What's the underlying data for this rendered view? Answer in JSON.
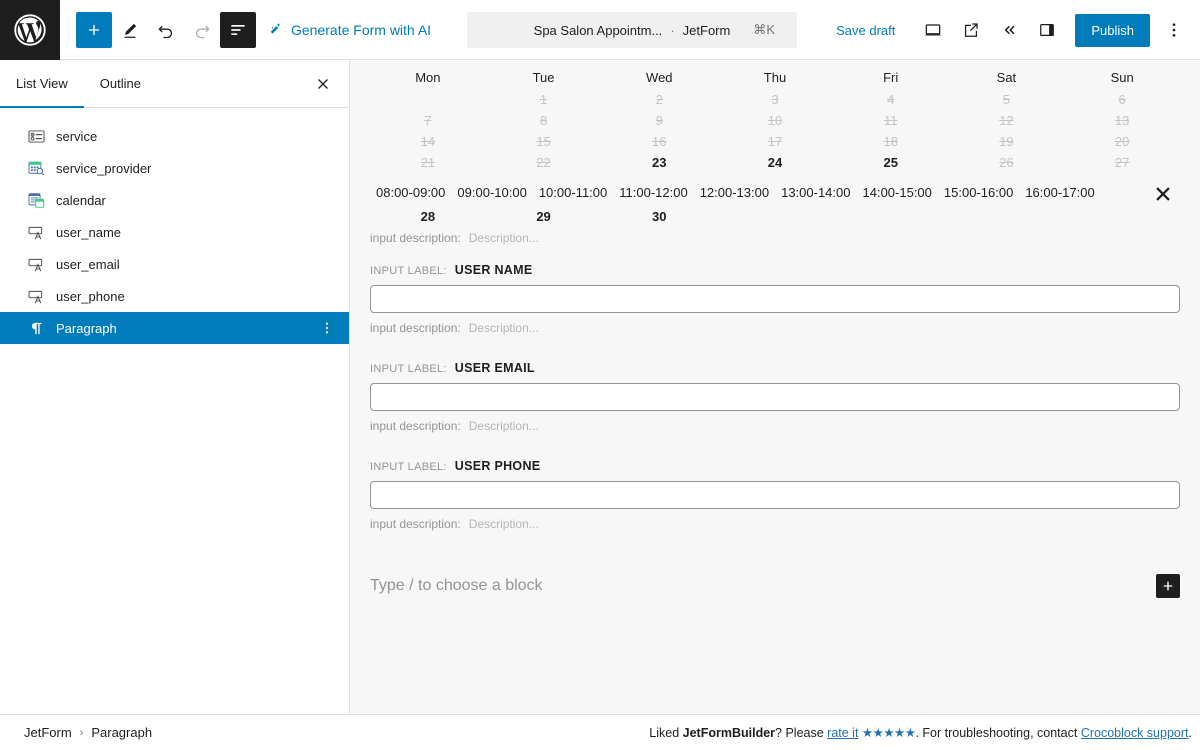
{
  "topbar": {
    "logo_icon": "wordpress-logo-icon",
    "tools": [
      {
        "name": "add-block-button",
        "icon": "plus-icon",
        "style": "primary",
        "label": "+"
      },
      {
        "name": "edit-tool-button",
        "icon": "pencil-icon",
        "style": "plain",
        "label": ""
      },
      {
        "name": "undo-button",
        "icon": "undo-icon",
        "style": "plain",
        "label": ""
      },
      {
        "name": "redo-button",
        "icon": "redo-icon",
        "style": "dim",
        "label": ""
      },
      {
        "name": "list-view-button",
        "icon": "list-view-icon",
        "style": "active",
        "label": ""
      }
    ],
    "ai_button_label": "Generate Form with AI",
    "ai_button_icon": "magic-wand-icon",
    "document_title": "Spa Salon Appointm...",
    "document_separator": "·",
    "document_type": "JetForm",
    "command_shortcut": "⌘K",
    "save_draft_label": "Save draft",
    "publish_label": "Publish",
    "right_icons": [
      {
        "name": "view-desktop-button",
        "icon": "desktop-icon"
      },
      {
        "name": "preview-external-button",
        "icon": "external-link-icon"
      },
      {
        "name": "collapse-button",
        "icon": "double-chevron-left-icon"
      },
      {
        "name": "settings-sidebar-button",
        "icon": "sidebar-panel-icon"
      }
    ],
    "options_icon": "kebab-menu-icon",
    "accent_color": "#007cba"
  },
  "sidebar": {
    "tabs": [
      {
        "label": "List View",
        "selected": true
      },
      {
        "label": "Outline",
        "selected": false
      }
    ],
    "close_icon": "close-icon",
    "items": [
      {
        "label": "service",
        "icon": "select-field-icon",
        "selected": false
      },
      {
        "label": "service_provider",
        "icon": "date-picker-icon",
        "selected": false
      },
      {
        "label": "calendar",
        "icon": "calendar-field-icon",
        "selected": false
      },
      {
        "label": "user_name",
        "icon": "text-field-icon",
        "selected": false
      },
      {
        "label": "user_email",
        "icon": "text-field-icon",
        "selected": false
      },
      {
        "label": "user_phone",
        "icon": "text-field-icon",
        "selected": false
      },
      {
        "label": "Paragraph",
        "icon": "paragraph-icon",
        "selected": true
      }
    ],
    "selected_more_icon": "kebab-menu-icon",
    "selected_color": "#007cba"
  },
  "canvas": {
    "calendar": {
      "weekdays": [
        "Mon",
        "Tue",
        "Wed",
        "Thu",
        "Fri",
        "Sat",
        "Sun"
      ],
      "weeks": [
        [
          {
            "d": "",
            "state": "blank"
          },
          {
            "d": "1",
            "state": "off"
          },
          {
            "d": "2",
            "state": "off"
          },
          {
            "d": "3",
            "state": "off"
          },
          {
            "d": "4",
            "state": "off"
          },
          {
            "d": "5",
            "state": "off"
          },
          {
            "d": "6",
            "state": "off"
          }
        ],
        [
          {
            "d": "7",
            "state": "off"
          },
          {
            "d": "8",
            "state": "off"
          },
          {
            "d": "9",
            "state": "off"
          },
          {
            "d": "10",
            "state": "off"
          },
          {
            "d": "11",
            "state": "off"
          },
          {
            "d": "12",
            "state": "off"
          },
          {
            "d": "13",
            "state": "off"
          }
        ],
        [
          {
            "d": "14",
            "state": "off"
          },
          {
            "d": "15",
            "state": "off"
          },
          {
            "d": "16",
            "state": "off"
          },
          {
            "d": "17",
            "state": "off"
          },
          {
            "d": "18",
            "state": "off"
          },
          {
            "d": "19",
            "state": "off"
          },
          {
            "d": "20",
            "state": "off"
          }
        ],
        [
          {
            "d": "21",
            "state": "off"
          },
          {
            "d": "22",
            "state": "off"
          },
          {
            "d": "23",
            "state": "on"
          },
          {
            "d": "24",
            "state": "on"
          },
          {
            "d": "25",
            "state": "on"
          },
          {
            "d": "26",
            "state": "off"
          },
          {
            "d": "27",
            "state": "off"
          }
        ]
      ],
      "tail_row": [
        "28",
        "29",
        "30",
        "",
        "",
        "",
        ""
      ],
      "timeslots": [
        "08:00-09:00",
        "09:00-10:00",
        "10:00-11:00",
        "11:00-12:00",
        "12:00-13:00",
        "13:00-14:00",
        "14:00-15:00",
        "15:00-16:00",
        "16:00-17:00"
      ],
      "timeslots_close_icon": "close-icon",
      "description_key": "input description:",
      "description_value": "Description..."
    },
    "fields": [
      {
        "label_key": "INPUT LABEL:",
        "label_value": "USER NAME",
        "value": "",
        "desc_key": "input description:",
        "desc_value": "Description..."
      },
      {
        "label_key": "INPUT LABEL:",
        "label_value": "USER EMAIL",
        "value": "",
        "desc_key": "input description:",
        "desc_value": "Description..."
      },
      {
        "label_key": "INPUT LABEL:",
        "label_value": "USER PHONE",
        "value": "",
        "desc_key": "input description:",
        "desc_value": "Description..."
      }
    ],
    "appender": {
      "placeholder": "Type / to choose a block",
      "add_icon": "plus-icon"
    }
  },
  "footer": {
    "breadcrumb": [
      "JetForm",
      "Paragraph"
    ],
    "breadcrumb_separator": "›",
    "credit_prefix": "Liked ",
    "credit_brand": "JetFormBuilder",
    "credit_mid": "? Please ",
    "credit_rate_link": "rate it",
    "credit_stars": "★★★★★",
    "credit_after_stars": ". For troubleshooting, contact ",
    "credit_support_link": "Crocoblock support",
    "credit_end": "."
  }
}
